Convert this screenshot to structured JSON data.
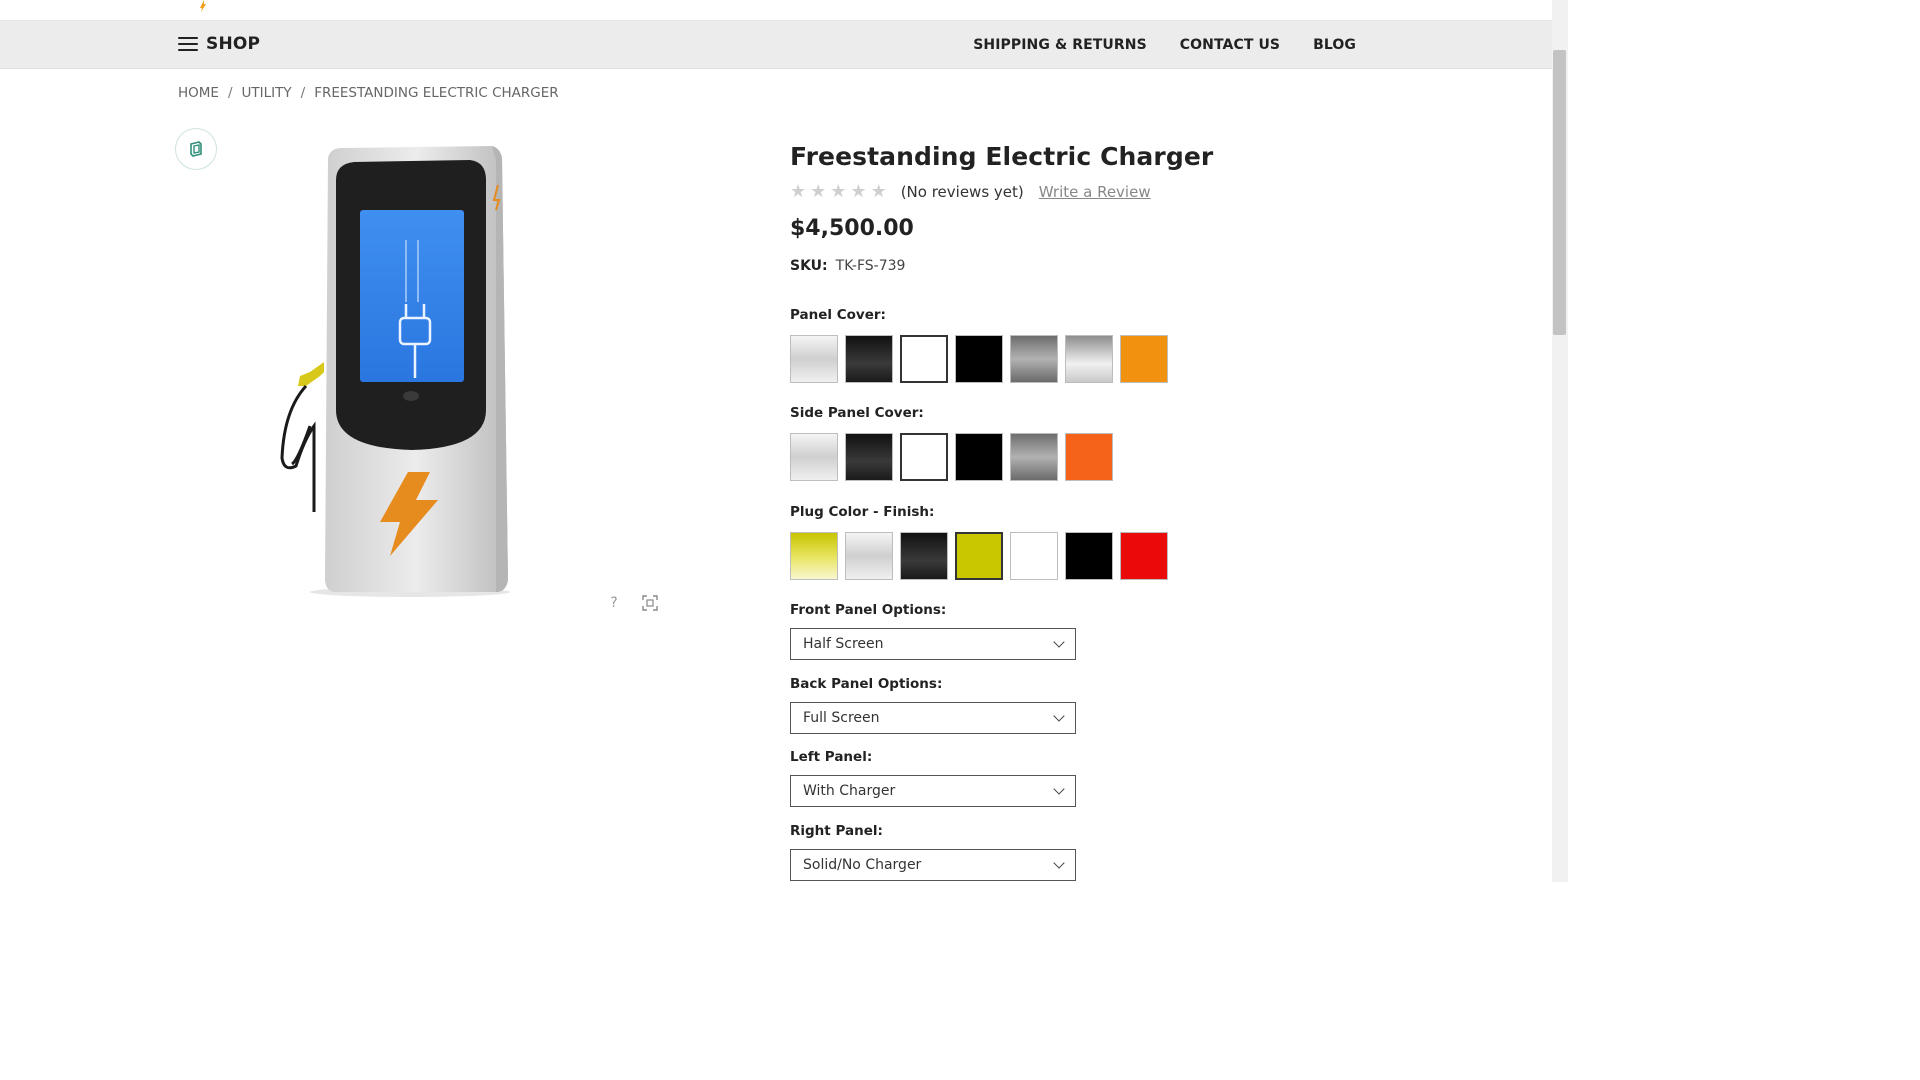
{
  "nav": {
    "shop_label": "SHOP",
    "links": [
      "SHIPPING & RETURNS",
      "CONTACT US",
      "BLOG"
    ]
  },
  "breadcrumb": [
    "HOME",
    "UTILITY",
    "FREESTANDING ELECTRIC CHARGER"
  ],
  "product": {
    "title": "Freestanding Electric Charger",
    "rating": 0,
    "reviews_text": "(No reviews yet)",
    "write_review": "Write a Review",
    "price": "$4,500.00",
    "sku_label": "SKU:",
    "sku_value": "TK-FS-739"
  },
  "options": {
    "panel_cover": {
      "label": "Panel Cover:",
      "swatches": [
        "silver-gradient",
        "black-gloss",
        "white",
        "black",
        "gunmetal",
        "chrome",
        "orange"
      ],
      "colors": [
        "#d9d9d9",
        "#2b2b2b",
        "#ffffff",
        "#000000",
        "#8a8a8a",
        "#cfcfcf",
        "#f0920f"
      ],
      "selected_index": 2
    },
    "side_panel_cover": {
      "label": "Side Panel Cover:",
      "swatches": [
        "silver-gradient",
        "black-gloss",
        "white",
        "black",
        "gunmetal",
        "orange-red"
      ],
      "colors": [
        "#d9d9d9",
        "#2b2b2b",
        "#ffffff",
        "#000000",
        "#8a8a8a",
        "#f5621a"
      ],
      "selected_index": 2
    },
    "plug_color": {
      "label": "Plug Color - Finish:",
      "swatches": [
        "yellow-gloss",
        "silver-gradient",
        "black-gloss",
        "yellow",
        "white",
        "black",
        "red"
      ],
      "colors": [
        "#d6d21e",
        "#d9d9d9",
        "#2b2b2b",
        "#c9c800",
        "#ffffff",
        "#000000",
        "#ea0a0a"
      ],
      "selected_index": 3
    },
    "front_panel": {
      "label": "Front Panel Options:",
      "value": "Half Screen"
    },
    "back_panel": {
      "label": "Back Panel Options:",
      "value": "Full Screen"
    },
    "left_panel": {
      "label": "Left Panel:",
      "value": "With Charger"
    },
    "right_panel": {
      "label": "Right Panel:",
      "value": "Solid/No Charger"
    }
  },
  "image_tools": [
    "help-icon",
    "fullscreen-icon"
  ]
}
